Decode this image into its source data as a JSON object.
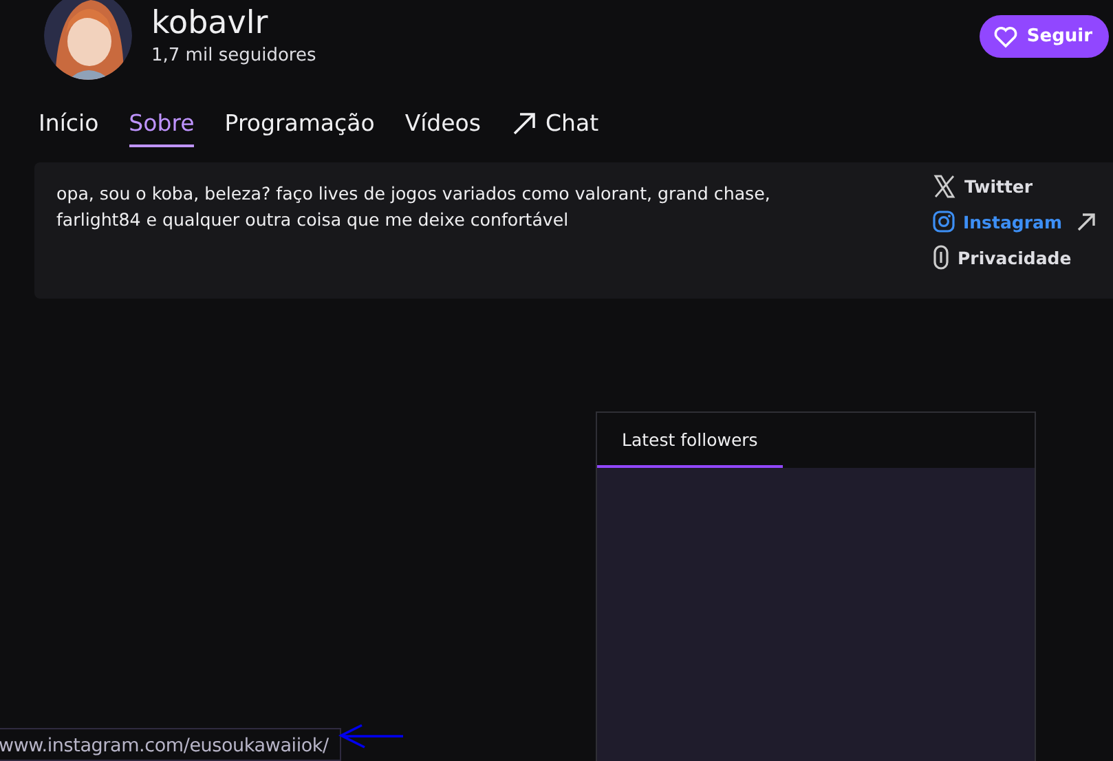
{
  "channel": {
    "name": "kobavlr",
    "followers": "1,7 mil seguidores"
  },
  "follow_button": {
    "label": "Seguir"
  },
  "tabs": [
    {
      "label": "Início",
      "selected": false
    },
    {
      "label": "Sobre",
      "selected": true
    },
    {
      "label": "Programação",
      "selected": false
    },
    {
      "label": "Vídeos",
      "selected": false
    },
    {
      "label": "Chat",
      "selected": false,
      "kind": "external"
    }
  ],
  "about": {
    "bio": "opa, sou o koba, beleza? faço lives de jogos variados como valorant, grand chase, farlight84 e qualquer outra coisa que me deixe confortável",
    "links": [
      {
        "kind": "x",
        "label": "Twitter",
        "hovered": false
      },
      {
        "kind": "instagram",
        "label": "Instagram",
        "hovered": true
      },
      {
        "kind": "privacy",
        "label": "Privacidade",
        "hovered": false
      }
    ]
  },
  "panel": {
    "tabs": [
      {
        "label": "Latest followers",
        "selected": true
      }
    ]
  },
  "status_url": "www.instagram.com/eusoukawaiiok/"
}
